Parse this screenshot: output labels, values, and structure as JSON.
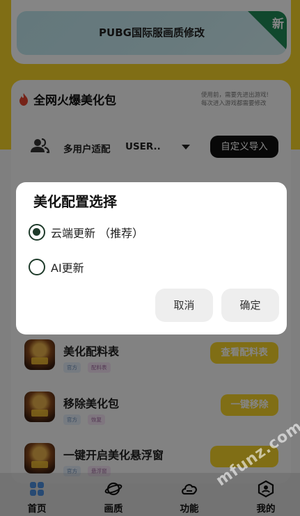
{
  "banner": {
    "title": "PUBG国际服画质修改",
    "badge": "新"
  },
  "section": {
    "title": "全网火爆美化包",
    "note": "使用前，需要先进出游戏!\n每次进入游戏都需要修改"
  },
  "user_row": {
    "label": "多用户适配",
    "value": "USER..",
    "custom_button": "自定义导入"
  },
  "items": [
    {
      "title": "美化配料表",
      "tags": [
        "官方",
        "配料表"
      ],
      "button": "查看配料表"
    },
    {
      "title": "移除美化包",
      "tags": [
        "官方",
        "恢复"
      ],
      "button": "一键移除"
    },
    {
      "title": "一键开启美化悬浮窗",
      "tags": [
        "官方",
        "悬浮窗"
      ],
      "button": ""
    }
  ],
  "dialog": {
    "title": "美化配置选择",
    "options": [
      {
        "label": "云端更新 （推荐）",
        "checked": true
      },
      {
        "label": "AI更新",
        "checked": false
      }
    ],
    "cancel": "取消",
    "confirm": "确定"
  },
  "nav": [
    {
      "label": "首页",
      "icon": "home-icon"
    },
    {
      "label": "画质",
      "icon": "planet-icon"
    },
    {
      "label": "功能",
      "icon": "cloud-icon"
    },
    {
      "label": "我的",
      "icon": "profile-icon"
    }
  ],
  "watermark": "mfunz.com",
  "colors": {
    "accent": "#f5d32a",
    "dark": "#111111",
    "badge": "#1f8b57"
  }
}
